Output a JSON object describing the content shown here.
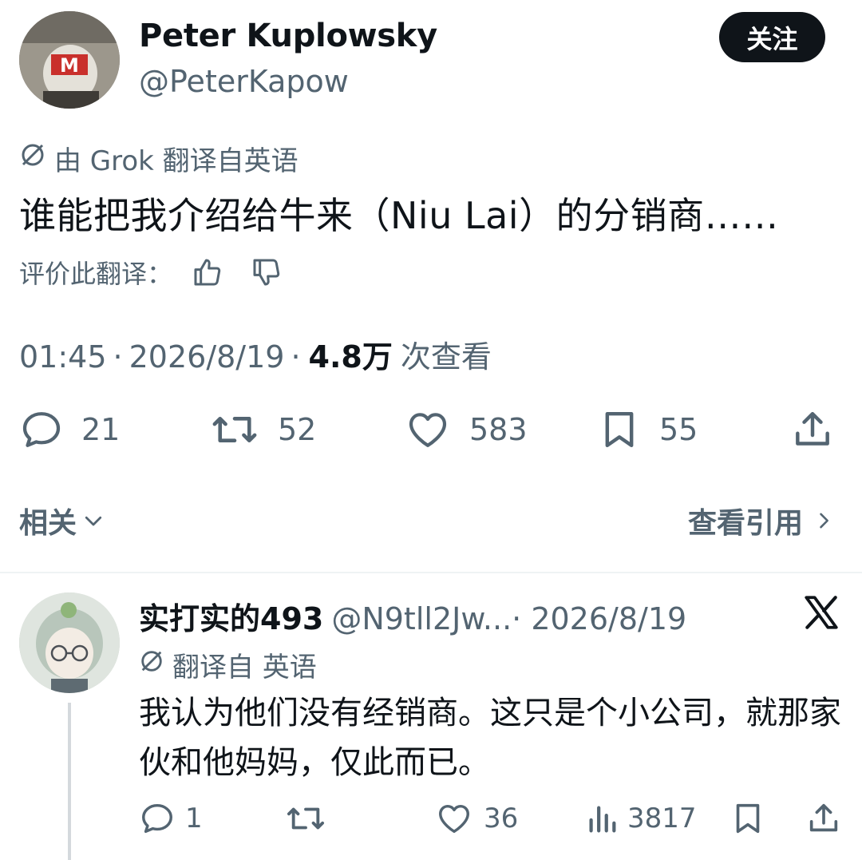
{
  "tweet": {
    "author": {
      "name": "Peter Kuplowsky",
      "handle": "@PeterKapow"
    },
    "follow_label": "关注",
    "translation_label": "由 Grok 翻译自英语",
    "text": "谁能把我介绍给牛来（Niu Lai）的分销商……",
    "rate_translation_label": "评价此翻译：",
    "time": "01:45",
    "date": "2026/8/19",
    "separator": "·",
    "views_count": "4.8万",
    "views_label": "次查看",
    "stats": {
      "replies": "21",
      "reposts": "52",
      "likes": "583",
      "bookmarks": "55"
    },
    "related_label": "相关",
    "view_quotes_label": "查看引用"
  },
  "reply": {
    "author": {
      "name": "实打实的493",
      "handle": "@N9tll2Jw...",
      "date": "· 2026/8/19"
    },
    "translation_label": "翻译自 英语",
    "text": "我认为他们没有经销商。这只是个小公司，就那家伙和他妈妈，仅此而已。",
    "stats": {
      "replies": "1",
      "reposts": "",
      "likes": "36",
      "views": "3817"
    }
  },
  "colors": {
    "text": "#0f1419",
    "secondary": "#536471",
    "button_bg": "#0f1419",
    "divider": "#eff3f4"
  },
  "icons": [
    "translate-slash-icon",
    "thumbs-up-icon",
    "thumbs-down-icon",
    "reply-icon",
    "repost-icon",
    "like-icon",
    "bookmark-icon",
    "share-icon",
    "chevron-down-icon",
    "chevron-right-icon",
    "x-logo-icon",
    "views-icon"
  ]
}
